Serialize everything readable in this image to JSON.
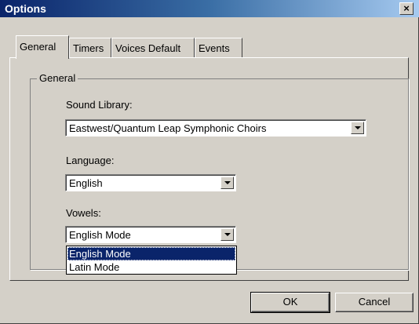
{
  "window": {
    "title": "Options",
    "close_label": "×"
  },
  "tabs": [
    {
      "label": "General",
      "active": true
    },
    {
      "label": "Timers",
      "active": false
    },
    {
      "label": "Voices Default",
      "active": false
    },
    {
      "label": "Events",
      "active": false
    }
  ],
  "group": {
    "title": "General",
    "sound_library": {
      "label": "Sound Library:",
      "value": "Eastwest/Quantum Leap Symphonic Choirs"
    },
    "language": {
      "label": "Language:",
      "value": "English"
    },
    "vowels": {
      "label": "Vowels:",
      "value": "English Mode",
      "options": [
        "English Mode",
        "Latin Mode"
      ],
      "highlighted": "English Mode"
    }
  },
  "buttons": {
    "ok": "OK",
    "cancel": "Cancel"
  }
}
